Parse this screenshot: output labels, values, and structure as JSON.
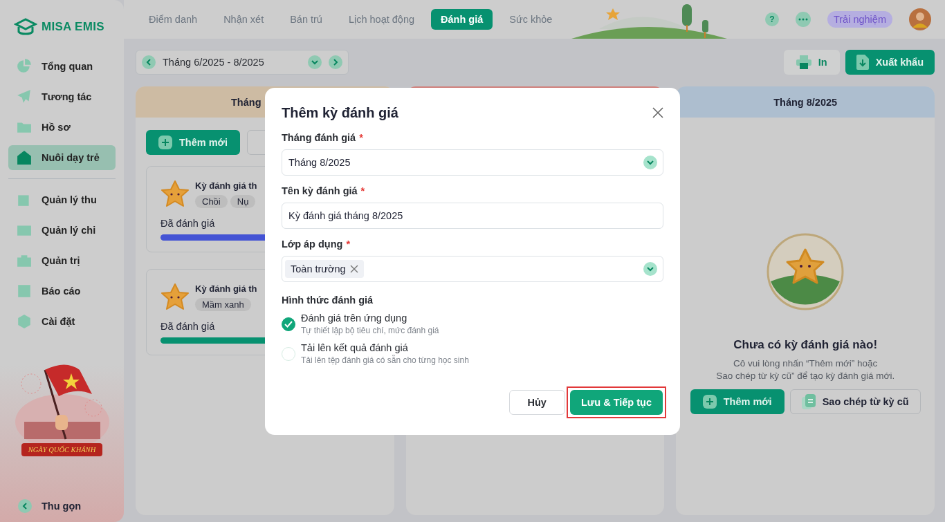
{
  "sidebar": {
    "logo": "MISA EMIS",
    "primary_items": [
      {
        "label": "Tổng quan",
        "selected": false
      },
      {
        "label": "Tương tác",
        "selected": false
      },
      {
        "label": "Hồ sơ",
        "selected": false
      },
      {
        "label": "Nuôi dạy trẻ",
        "selected": true
      }
    ],
    "secondary_items": [
      {
        "label": "Quản lý thu",
        "selected": false
      },
      {
        "label": "Quản lý chi",
        "selected": false
      },
      {
        "label": "Quản trị",
        "selected": false
      },
      {
        "label": "Báo cáo",
        "selected": false
      },
      {
        "label": "Cài đặt",
        "selected": false
      }
    ],
    "banner_text": "NGÀY QUỐC KHÁNH",
    "collapse": "Thu gọn"
  },
  "top_tabs": [
    {
      "label": "Điểm danh",
      "selected": false
    },
    {
      "label": "Nhận xét",
      "selected": false
    },
    {
      "label": "Bán trú",
      "selected": false
    },
    {
      "label": "Lịch hoạt động",
      "selected": false
    },
    {
      "label": "Đánh giá",
      "selected": true
    },
    {
      "label": "Sức khỏe",
      "selected": false
    }
  ],
  "top_right": {
    "help": "?",
    "trial": "Trải nghiệm"
  },
  "toolbar": {
    "period": "Tháng 6/2025 - 8/2025",
    "print": "In",
    "export": "Xuất khẩu"
  },
  "columns": [
    {
      "kind": "list",
      "title": "Tháng",
      "add_button": "Thêm mới",
      "cards": [
        {
          "title": "Kỳ đánh giá th",
          "tags": [
            "Chồi",
            "Nụ"
          ],
          "status": "Đã đánh giá",
          "color": "#4353d4"
        },
        {
          "title": "Kỳ đánh giá th",
          "tags": [
            "Mầm xanh"
          ],
          "status": "Đã đánh giá",
          "color": "#079170"
        }
      ]
    },
    {
      "kind": "hidden"
    },
    {
      "kind": "empty",
      "title": "Tháng 8/2025",
      "empty_title": "Chưa có kỳ đánh giá nào!",
      "empty_text": "Cô vui lòng nhấn “Thêm mới” hoặc\nSao chép từ kỳ cũ” để tạo kỳ đánh giá mới.",
      "add_button": "Thêm mới",
      "copy_button": "Sao chép từ kỳ cũ"
    }
  ],
  "dialog": {
    "title": "Thêm kỳ đánh giá",
    "fields": [
      {
        "kind": "select",
        "label": "Tháng đánh giá",
        "required_mark": "*",
        "value": "Tháng 8/2025"
      },
      {
        "kind": "text",
        "label": "Tên kỳ đánh giá",
        "required_mark": "*",
        "value": "Kỳ đánh giá tháng 8/2025"
      },
      {
        "kind": "tags",
        "label": "Lớp áp dụng",
        "required_mark": "*",
        "tags": [
          "Toàn trường"
        ]
      }
    ],
    "method_label": "Hình thức đánh giá",
    "methods": [
      {
        "title": "Đánh giá trên ứng dụng",
        "description": "Tự thiết lập bộ tiêu chí, mức đánh giá",
        "selected": true
      },
      {
        "title": "Tải lên kết quả đánh giá",
        "description": "Tải lên tệp đánh giá có sẵn cho từng học sinh",
        "selected": false
      }
    ],
    "cancel": "Hủy",
    "submit": "Lưu & Tiếp tục",
    "submit_highlighted": true
  }
}
